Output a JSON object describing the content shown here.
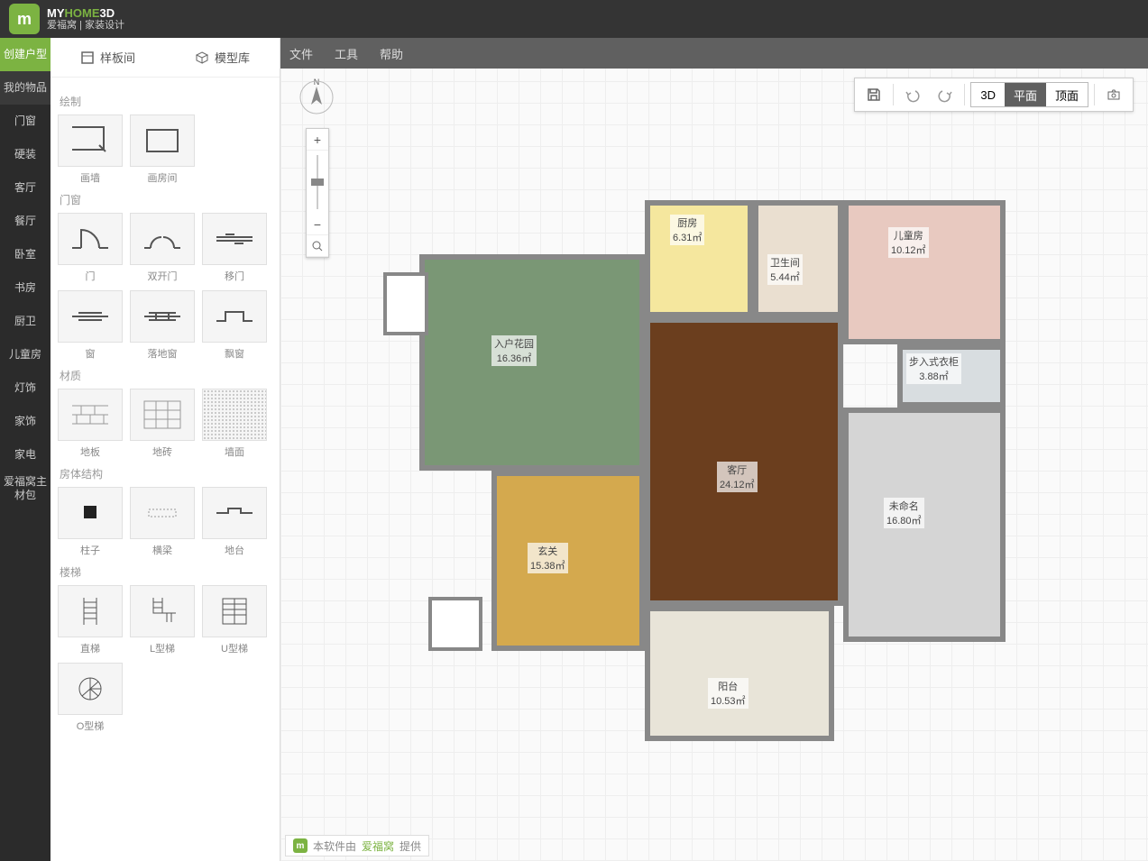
{
  "header": {
    "logo_my": "MY",
    "logo_home": "HOME",
    "logo_3d": "3D",
    "logo_sub": "爱福窝 | 家装设计"
  },
  "leftnav": {
    "items": [
      {
        "label": "创建户型",
        "active": true
      },
      {
        "label": "我的物品",
        "dark": true
      },
      {
        "label": "门窗"
      },
      {
        "label": "硬装"
      },
      {
        "label": "客厅"
      },
      {
        "label": "餐厅"
      },
      {
        "label": "卧室"
      },
      {
        "label": "书房"
      },
      {
        "label": "厨卫"
      },
      {
        "label": "儿童房"
      },
      {
        "label": "灯饰"
      },
      {
        "label": "家饰"
      },
      {
        "label": "家电"
      },
      {
        "label": "爱福窝主材包"
      }
    ]
  },
  "sidebar_tabs": {
    "template": "样板间",
    "library": "模型库"
  },
  "sections": {
    "draw": {
      "title": "绘制",
      "items": [
        {
          "label": "画墙"
        },
        {
          "label": "画房间"
        }
      ]
    },
    "doorwin": {
      "title": "门窗",
      "items": [
        {
          "label": "门"
        },
        {
          "label": "双开门"
        },
        {
          "label": "移门"
        },
        {
          "label": "窗"
        },
        {
          "label": "落地窗"
        },
        {
          "label": "飘窗"
        }
      ]
    },
    "material": {
      "title": "材质",
      "items": [
        {
          "label": "地板"
        },
        {
          "label": "地砖"
        },
        {
          "label": "墙面"
        }
      ]
    },
    "structure": {
      "title": "房体结构",
      "items": [
        {
          "label": "柱子"
        },
        {
          "label": "横梁"
        },
        {
          "label": "地台"
        }
      ]
    },
    "stairs": {
      "title": "楼梯",
      "items": [
        {
          "label": "直梯"
        },
        {
          "label": "L型梯"
        },
        {
          "label": "U型梯"
        },
        {
          "label": "O型梯"
        }
      ]
    }
  },
  "menubar": {
    "file": "文件",
    "tools": "工具",
    "help": "帮助"
  },
  "toolbar": {
    "view_3d": "3D",
    "view_plan": "平面",
    "view_top": "顶面"
  },
  "rooms": {
    "kitchen": {
      "name": "厨房",
      "area": "6.31㎡"
    },
    "bath": {
      "name": "卫生间",
      "area": "5.44㎡"
    },
    "kids": {
      "name": "儿童房",
      "area": "10.12㎡"
    },
    "garden": {
      "name": "入户花园",
      "area": "16.36㎡"
    },
    "closet": {
      "name": "步入式衣柜",
      "area": "3.88㎡"
    },
    "living": {
      "name": "客厅",
      "area": "24.12㎡"
    },
    "unnamed": {
      "name": "未命名",
      "area": "16.80㎡"
    },
    "foyer": {
      "name": "玄关",
      "area": "15.38㎡"
    },
    "balcony": {
      "name": "阳台",
      "area": "10.53㎡"
    }
  },
  "compass": {
    "n": "N"
  },
  "watermark": {
    "prefix": "本软件由",
    "brand": "爱福窝",
    "suffix": "提供"
  }
}
